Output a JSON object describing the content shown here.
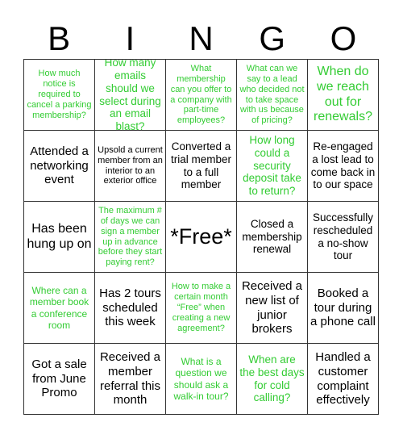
{
  "title_letters": [
    "B",
    "I",
    "N",
    "G",
    "O"
  ],
  "colors": {
    "question": "#33cc33",
    "task": "#000000",
    "grid": "#333333"
  },
  "cells": [
    {
      "text": "How much notice is required to cancel a parking membership?",
      "kind": "question"
    },
    {
      "text": "How many emails should we select during an email blast?",
      "kind": "question"
    },
    {
      "text": "What membership can you offer to a company with part-time employees?",
      "kind": "question"
    },
    {
      "text": "What can we say to a lead who decided not to take space with us because of pricing?",
      "kind": "question"
    },
    {
      "text": "When do we reach out for renewals?",
      "kind": "question"
    },
    {
      "text": "Attended a networking event",
      "kind": "task"
    },
    {
      "text": "Upsold a current member from an interior to an exterior office",
      "kind": "task"
    },
    {
      "text": "Converted a trial member to a full member",
      "kind": "task"
    },
    {
      "text": "How long could a security deposit take to return?",
      "kind": "question"
    },
    {
      "text": "Re-engaged a lost lead to come back in to our space",
      "kind": "task"
    },
    {
      "text": "Has been hung up on",
      "kind": "task"
    },
    {
      "text": "The maximum # of days we can sign a member up in advance before they start paying rent?",
      "kind": "question"
    },
    {
      "text": "*Free*",
      "kind": "free"
    },
    {
      "text": "Closed a membership renewal",
      "kind": "task"
    },
    {
      "text": "Successfully rescheduled a no-show tour",
      "kind": "task"
    },
    {
      "text": "Where can a member book a conference room",
      "kind": "question"
    },
    {
      "text": "Has 2 tours scheduled this week",
      "kind": "task"
    },
    {
      "text": "How to make a certain month “Free” when creating a new agreement?",
      "kind": "question"
    },
    {
      "text": "Received a new list of junior brokers",
      "kind": "task"
    },
    {
      "text": "Booked a tour during a phone call",
      "kind": "task"
    },
    {
      "text": "Got a sale from June Promo",
      "kind": "task"
    },
    {
      "text": "Received a member referral this month",
      "kind": "task"
    },
    {
      "text": "What is a question we should ask a walk-in tour?",
      "kind": "question"
    },
    {
      "text": "When are the best days for cold calling?",
      "kind": "question"
    },
    {
      "text": "Handled a customer complaint effectively",
      "kind": "task"
    }
  ]
}
